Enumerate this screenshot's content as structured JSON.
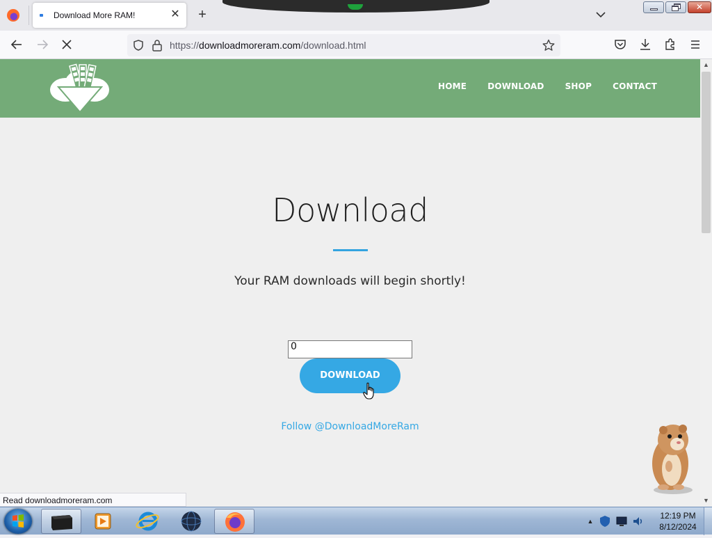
{
  "browser": {
    "tab": {
      "title": "Download More RAM!"
    },
    "address": {
      "domain": "downloadmoreram.com",
      "scheme": "https://",
      "path": "/download.html"
    },
    "status_text": "Read downloadmoreram.com"
  },
  "site": {
    "nav": [
      "HOME",
      "DOWNLOAD",
      "SHOP",
      "CONTACT"
    ],
    "heading": "Download",
    "subtitle": "Your RAM downloads will begin shortly!",
    "amount_value": "0",
    "download_button": "DOWNLOAD",
    "follow_link": "Follow @DownloadMoreRam",
    "colors": {
      "header": "#74ab78",
      "accent": "#35a8e4"
    }
  },
  "taskbar": {
    "items": [
      "start-orb-icon",
      "terminal-icon",
      "media-player-icon",
      "internet-explorer-icon",
      "globe-icon",
      "firefox-icon"
    ],
    "clock": {
      "time": "12:19 PM",
      "date": "8/12/2024"
    }
  }
}
